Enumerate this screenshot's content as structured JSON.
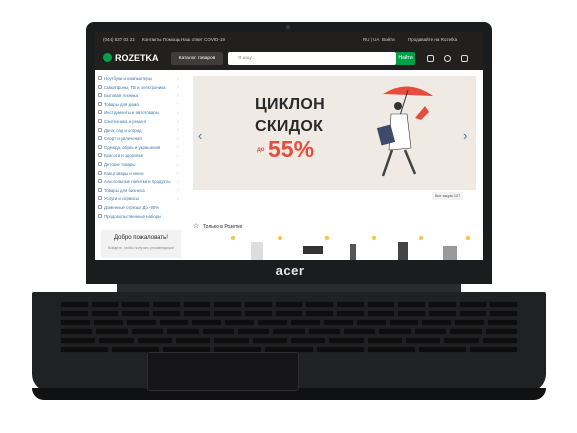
{
  "device": {
    "brand_logo": "acer"
  },
  "topbar": {
    "phone": "(044) 537 02 22",
    "links": [
      "Контакты",
      "Помощь",
      "Наш ответ COVID-19"
    ],
    "lang": "RU | UA",
    "signin": "Войти",
    "seller_link": "Продавайте на Rozetka"
  },
  "header": {
    "brand": "ROZETKA",
    "catalog_label": "Каталог товаров",
    "search_placeholder": "Я ищу...",
    "search_button": "Найти",
    "icons": [
      "scales-icon",
      "heart-icon",
      "cart-icon"
    ]
  },
  "sidebar": {
    "items": [
      "Ноутбуки и компьютеры",
      "Смартфоны, ТВ и электроника",
      "Бытовая техника",
      "Товары для дома",
      "Инструменты и автотовары",
      "Сантехника и ремонт",
      "Дача, сад и огород",
      "Спорт и увлечения",
      "Одежда, обувь и украшения",
      "Красота и здоровье",
      "Детские товары",
      "Канцтовары и книги",
      "Алкогольные напитки и продукты",
      "Товары для бизнеса",
      "Услуги и сервисы",
      "Доменные отрезы! До -90%",
      "Продовольственные наборы"
    ],
    "welcome_title": "Добро пожаловать!",
    "welcome_sub": "Войдите, чтобы получать рекомендации"
  },
  "banner": {
    "line1": "ЦИКЛОН",
    "line2": "СКИДОК",
    "prefix": "до",
    "percent": "55%",
    "bg_color": "#efebe4",
    "accent_color": "#e84c3d"
  },
  "main": {
    "all_actions": "Все акции 107",
    "section_title": "Только в Розетке"
  }
}
